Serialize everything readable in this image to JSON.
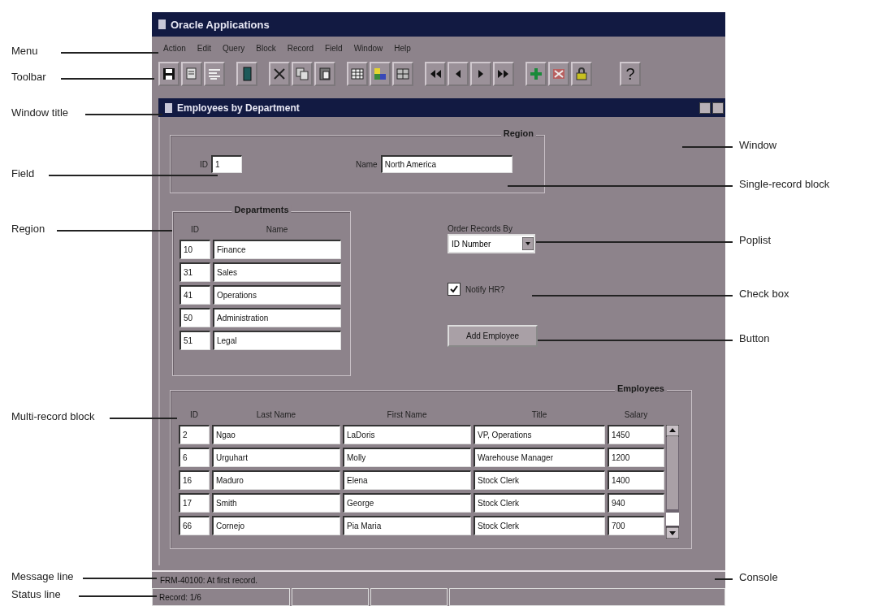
{
  "app_window": {
    "title": "Oracle Applications"
  },
  "menu": [
    "Action",
    "Edit",
    "Query",
    "Block",
    "Record",
    "Field",
    "Window",
    "Help"
  ],
  "toolbar": {
    "help": "?"
  },
  "form_window": {
    "title": "Employees by Department"
  },
  "region_block": {
    "title": "Region",
    "id_label": "ID",
    "id_value": "1",
    "name_label": "Name",
    "name_value": "North America"
  },
  "departments": {
    "title": "Departments",
    "columns": [
      "ID",
      "Name"
    ],
    "rows": [
      {
        "id": "10",
        "name": "Finance"
      },
      {
        "id": "31",
        "name": "Sales"
      },
      {
        "id": "41",
        "name": "Operations"
      },
      {
        "id": "50",
        "name": "Administration"
      },
      {
        "id": "51",
        "name": "Legal"
      }
    ]
  },
  "order_by": {
    "label": "Order Records By",
    "value": "ID Number"
  },
  "notify": {
    "label": "Notify HR?",
    "checked": true
  },
  "add_button": "Add Employee",
  "employees": {
    "title": "Employees",
    "columns": [
      "ID",
      "Last Name",
      "First Name",
      "Title",
      "Salary"
    ],
    "rows": [
      [
        "2",
        "Ngao",
        "LaDoris",
        "VP, Operations",
        "1450"
      ],
      [
        "6",
        "Urguhart",
        "Molly",
        "Warehouse Manager",
        "1200"
      ],
      [
        "16",
        "Maduro",
        "Elena",
        "Stock Clerk",
        "1400"
      ],
      [
        "17",
        "Smith",
        "George",
        "Stock Clerk",
        "940"
      ],
      [
        "66",
        "Cornejo",
        "Pia Maria",
        "Stock Clerk",
        "700"
      ]
    ]
  },
  "message_line": "FRM-40100: At first record.",
  "status_line": [
    "Record: 1/6"
  ],
  "callouts_left": [
    "Menu",
    "Toolbar",
    "Window title",
    "Field",
    "Region",
    "Multi-record block",
    "Message line",
    "Status line"
  ],
  "callouts_right": [
    "Window",
    "Single-record block",
    "Poplist",
    "Check box",
    "Button",
    "Console"
  ]
}
